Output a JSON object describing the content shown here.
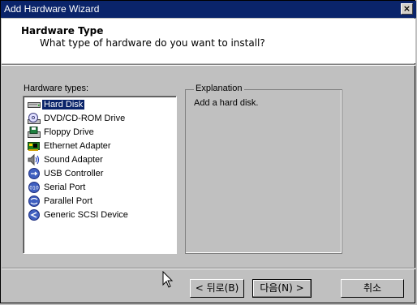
{
  "window": {
    "title": "Add Hardware Wizard",
    "close_label": "×"
  },
  "header": {
    "title": "Hardware Type",
    "subtitle": "What type of hardware do you want to install?"
  },
  "hardware_list": {
    "label": "Hardware types:",
    "selected_index": 0,
    "items": [
      {
        "label": "Hard Disk",
        "icon": "hard-disk-icon"
      },
      {
        "label": "DVD/CD-ROM Drive",
        "icon": "cdrom-icon"
      },
      {
        "label": "Floppy Drive",
        "icon": "floppy-icon"
      },
      {
        "label": "Ethernet Adapter",
        "icon": "ethernet-icon"
      },
      {
        "label": "Sound Adapter",
        "icon": "speaker-icon"
      },
      {
        "label": "USB Controller",
        "icon": "usb-icon"
      },
      {
        "label": "Serial Port",
        "icon": "serial-port-icon"
      },
      {
        "label": "Parallel Port",
        "icon": "parallel-port-icon"
      },
      {
        "label": "Generic SCSI Device",
        "icon": "scsi-icon"
      }
    ]
  },
  "explanation": {
    "legend": "Explanation",
    "text": "Add a hard disk."
  },
  "buttons": {
    "back": "< 뒤로(B)",
    "next": "다음(N) >",
    "cancel": "취소"
  },
  "colors": {
    "titlebar": "#0a246a",
    "selection": "#0a246a",
    "face": "#c0c0c0"
  }
}
